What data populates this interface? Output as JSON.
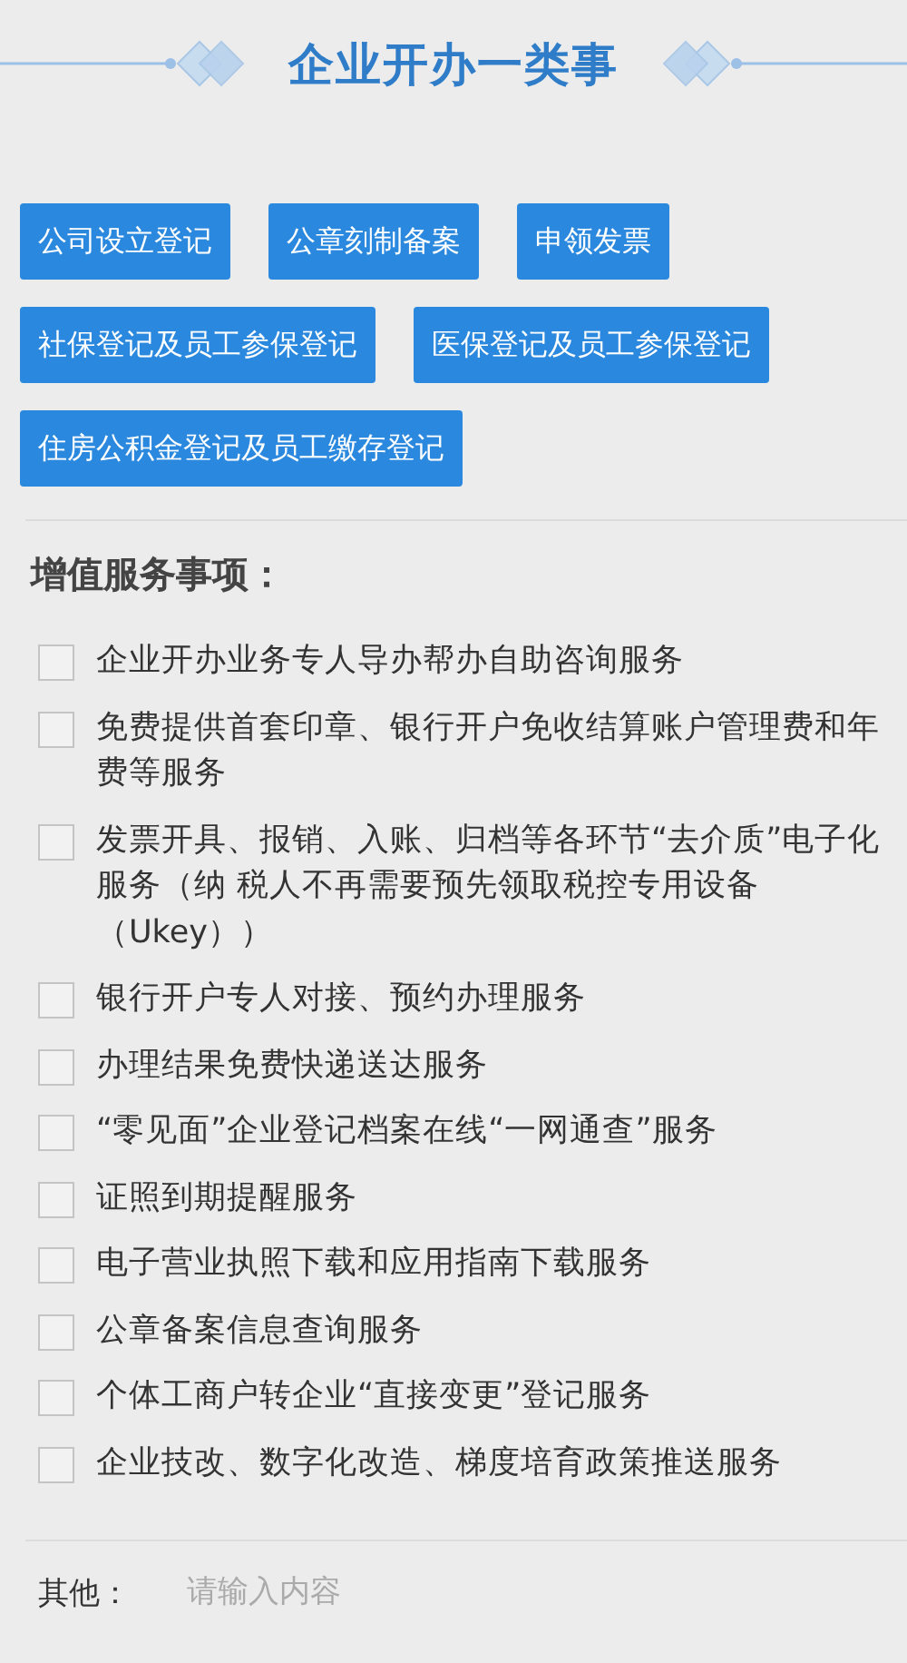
{
  "header": {
    "title": "企业开办一类事"
  },
  "services": [
    {
      "label": "公司设立登记"
    },
    {
      "label": "公章刻制备案"
    },
    {
      "label": "申领发票"
    },
    {
      "label": "社保登记及员工参保登记"
    },
    {
      "label": "医保登记及员工参保登记"
    },
    {
      "label": "住房公积金登记及员工缴存登记"
    }
  ],
  "value_added": {
    "heading": "增值服务事项：",
    "items": [
      {
        "label": "企业开办业务专人导办帮办自助咨询服务",
        "checked": false
      },
      {
        "label": "免费提供首套印章、银行开户免收结算账户管理费和年费等服务",
        "checked": false
      },
      {
        "label": "发票开具、报销、入账、归档等各环节“去介质”电子化服务（纳 税人不再需要预先领取税控专用设备（Ukey））",
        "checked": false
      },
      {
        "label": "银行开户专人对接、预约办理服务",
        "checked": false
      },
      {
        "label": "办理结果免费快递送达服务",
        "checked": false
      },
      {
        "label": "“零见面”企业登记档案在线“一网通查”服务",
        "checked": false
      },
      {
        "label": "证照到期提醒服务",
        "checked": false
      },
      {
        "label": "电子营业执照下载和应用指南下载服务",
        "checked": false
      },
      {
        "label": "公章备案信息查询服务",
        "checked": false
      },
      {
        "label": "个体工商户转企业“直接变更”登记服务",
        "checked": false
      },
      {
        "label": "企业技改、数字化改造、梯度培育政策推送服务",
        "checked": false
      }
    ]
  },
  "other": {
    "label": "其他：",
    "placeholder": "请输入内容"
  }
}
